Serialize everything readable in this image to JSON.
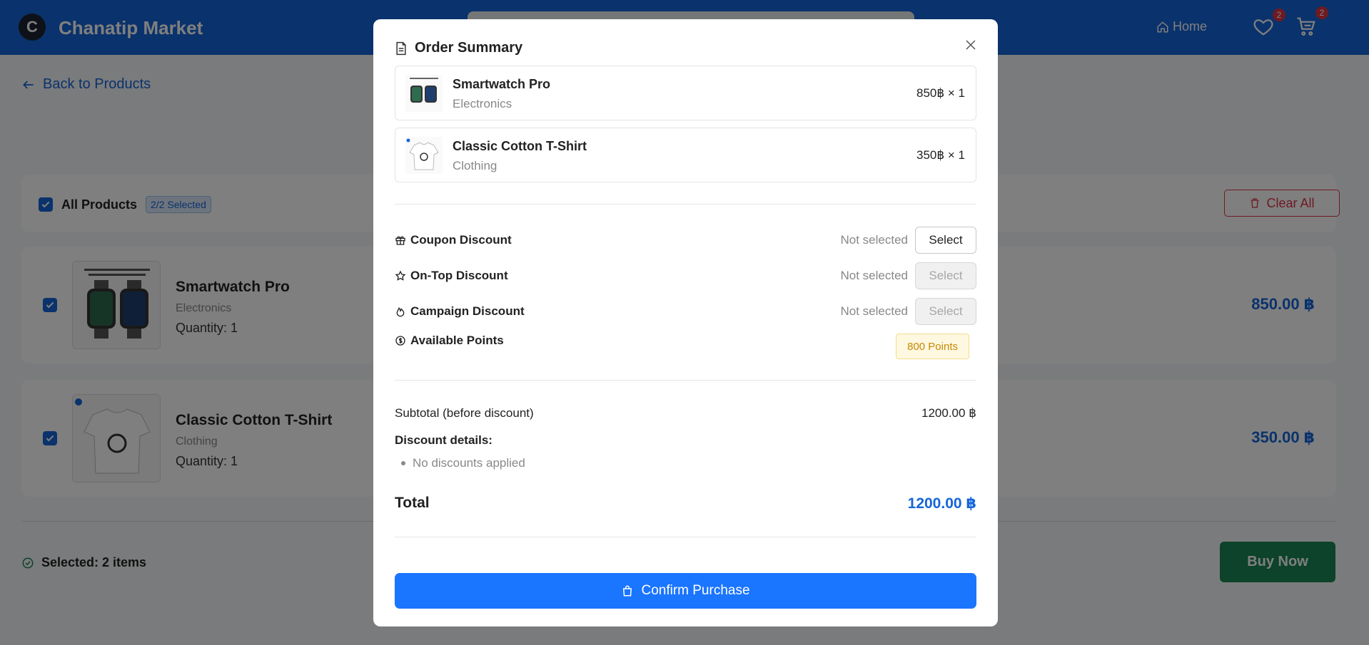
{
  "navbar": {
    "logo_letter": "C",
    "brand": "Chanatip Market",
    "home_label": "Home",
    "wishlist_count": "2",
    "cart_count": "2"
  },
  "back_link": "Back to Products",
  "cart": {
    "all_products_label": "All Products",
    "selected_badge": "2/2 Selected",
    "clear_all_label": "Clear All",
    "items": [
      {
        "name": "Smartwatch Pro",
        "category": "Electronics",
        "quantity": "Quantity: 1",
        "price": "850.00 ฿"
      },
      {
        "name": "Classic Cotton T-Shirt",
        "category": "Clothing",
        "quantity": "Quantity: 1",
        "price": "350.00 ฿"
      }
    ],
    "selected_info": "Selected: 2 items",
    "buy_now_label": "Buy Now"
  },
  "modal": {
    "title": "Order Summary",
    "items": [
      {
        "name": "Smartwatch Pro",
        "category": "Electronics",
        "price_qty": "850฿ × 1"
      },
      {
        "name": "Classic Cotton T-Shirt",
        "category": "Clothing",
        "price_qty": "350฿ × 1"
      }
    ],
    "discounts": [
      {
        "label": "Coupon Discount",
        "status": "Not selected",
        "button": "Select",
        "enabled": true,
        "icon": "gift-icon"
      },
      {
        "label": "On-Top Discount",
        "status": "Not selected",
        "button": "Select",
        "enabled": false,
        "icon": "star-icon"
      },
      {
        "label": "Campaign Discount",
        "status": "Not selected",
        "button": "Select",
        "enabled": false,
        "icon": "flame-icon"
      }
    ],
    "points": {
      "label": "Available Points",
      "value": "800 Points",
      "icon": "coin-icon"
    },
    "subtotal_label": "Subtotal (before discount)",
    "subtotal_value": "1200.00 ฿",
    "discount_details_label": "Discount details:",
    "discount_details_items": [
      "No discounts applied"
    ],
    "total_label": "Total",
    "total_value": "1200.00 ฿",
    "confirm_label": "Confirm Purchase"
  },
  "colors": {
    "primary": "#1565d8",
    "confirm": "#1a75ff",
    "buy_now": "#198754",
    "danger": "#dc3545",
    "points": "#c48a00"
  }
}
